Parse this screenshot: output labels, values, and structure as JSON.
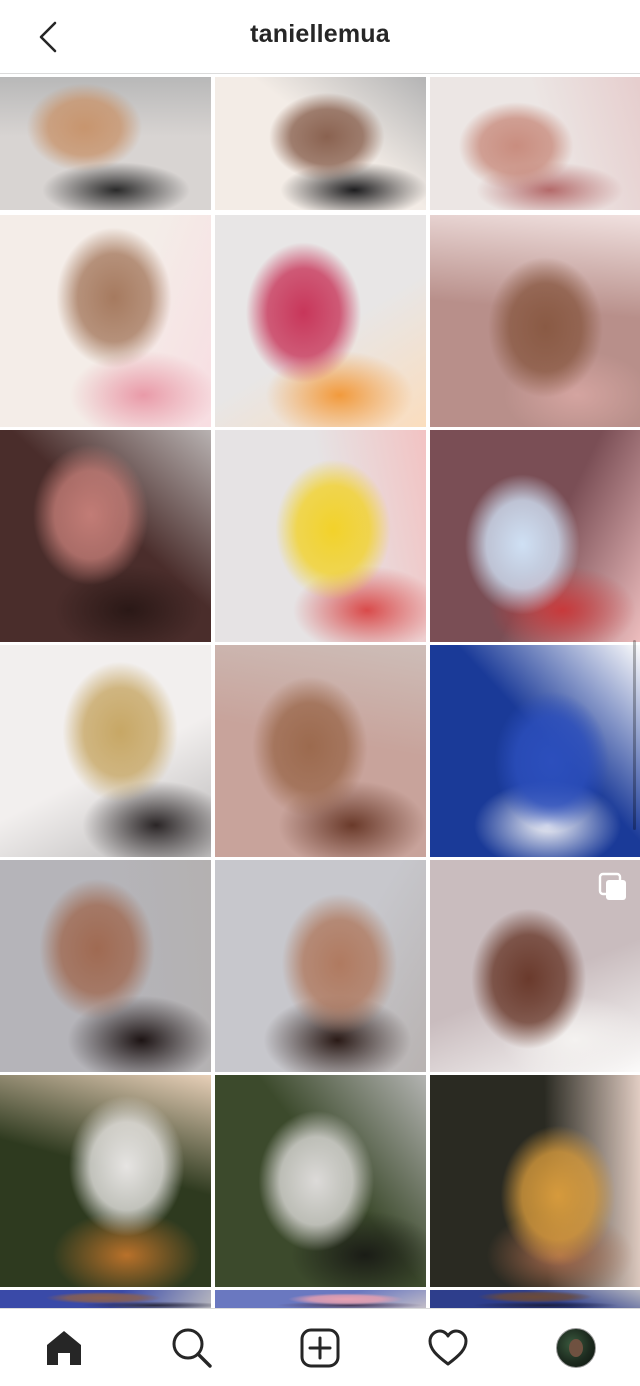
{
  "header": {
    "username": "taniellemua",
    "back_icon": "chevron-left-icon"
  },
  "grid": {
    "tiles": [
      {
        "name": "pregnant-belly-painting",
        "colors": [
          "#d8d4d2",
          "#c8956e",
          "#2a2a2a"
        ]
      },
      {
        "name": "brows-masked-man",
        "colors": [
          "#f3ece6",
          "#8a6250",
          "#1d1d1f"
        ]
      },
      {
        "name": "pink-lace-bralette",
        "colors": [
          "#ece6e4",
          "#c98d7f",
          "#b46a6a"
        ]
      },
      {
        "name": "brows-before-after",
        "colors": [
          "#f4ede8",
          "#a67a5f",
          "#e99aa8"
        ]
      },
      {
        "name": "colorful-gown-couch",
        "colors": [
          "#e8e6e6",
          "#c8365a",
          "#f29a3c"
        ]
      },
      {
        "name": "mauve-blazer-portrait",
        "colors": [
          "#b88f8a",
          "#8a5a44",
          "#d4a4a0"
        ]
      },
      {
        "name": "ladder-floral-dress",
        "colors": [
          "#4a2d2b",
          "#c27c76",
          "#2a1816"
        ]
      },
      {
        "name": "stickers-flatlay",
        "colors": [
          "#e6e3e4",
          "#f2d22a",
          "#d94a4a"
        ]
      },
      {
        "name": "school-uniform-curls",
        "colors": [
          "#7a4e55",
          "#cfe0f4",
          "#c8393b"
        ]
      },
      {
        "name": "makeup-palette-flatlay",
        "colors": [
          "#f2efee",
          "#c7a765",
          "#2a2526"
        ]
      },
      {
        "name": "smokey-eye-portrait",
        "colors": [
          "#c8a39b",
          "#9c6a4e",
          "#6a3a2a"
        ]
      },
      {
        "name": "blue-beanbag-pose",
        "colors": [
          "#1a3a98",
          "#2c4fbd",
          "#f4f4f6"
        ]
      },
      {
        "name": "braids-graphic-liner",
        "colors": [
          "#b5b4b9",
          "#a06a52",
          "#1d1414"
        ]
      },
      {
        "name": "braids-white-top",
        "colors": [
          "#c7c7cc",
          "#b07a60",
          "#2a1a16"
        ]
      },
      {
        "name": "curly-off-shoulder",
        "colors": [
          "#c9bcbe",
          "#6a3a2c",
          "#f4f2f0"
        ]
      },
      {
        "name": "white-gown-garden",
        "colors": [
          "#2e3a1f",
          "#e6e4e2",
          "#b9712a"
        ]
      },
      {
        "name": "fairytale-couple-woods",
        "colors": [
          "#3c4a2c",
          "#dcdad8",
          "#1a1c16"
        ]
      },
      {
        "name": "elf-couple-golden",
        "colors": [
          "#2a2a22",
          "#d69a3c",
          "#a76a4c"
        ]
      },
      {
        "name": "row-partial-1",
        "colors": [
          "#3a4aa8",
          "#8a6050",
          "#2a2a40"
        ]
      },
      {
        "name": "row-partial-2",
        "colors": [
          "#6a78c0",
          "#e8a0b0",
          "#4a3a58"
        ]
      },
      {
        "name": "row-partial-3",
        "colors": [
          "#2e3e8c",
          "#6a4a3a",
          "#1c2040"
        ]
      }
    ],
    "multi_post_index": 14
  },
  "bottom_nav": {
    "items": [
      {
        "name": "home",
        "icon": "home-icon",
        "active": true
      },
      {
        "name": "search",
        "icon": "search-icon",
        "active": false
      },
      {
        "name": "new-post",
        "icon": "plus-square-icon",
        "active": false
      },
      {
        "name": "activity",
        "icon": "heart-icon",
        "active": false
      },
      {
        "name": "profile",
        "icon": "profile-avatar-icon",
        "active": false
      }
    ]
  }
}
